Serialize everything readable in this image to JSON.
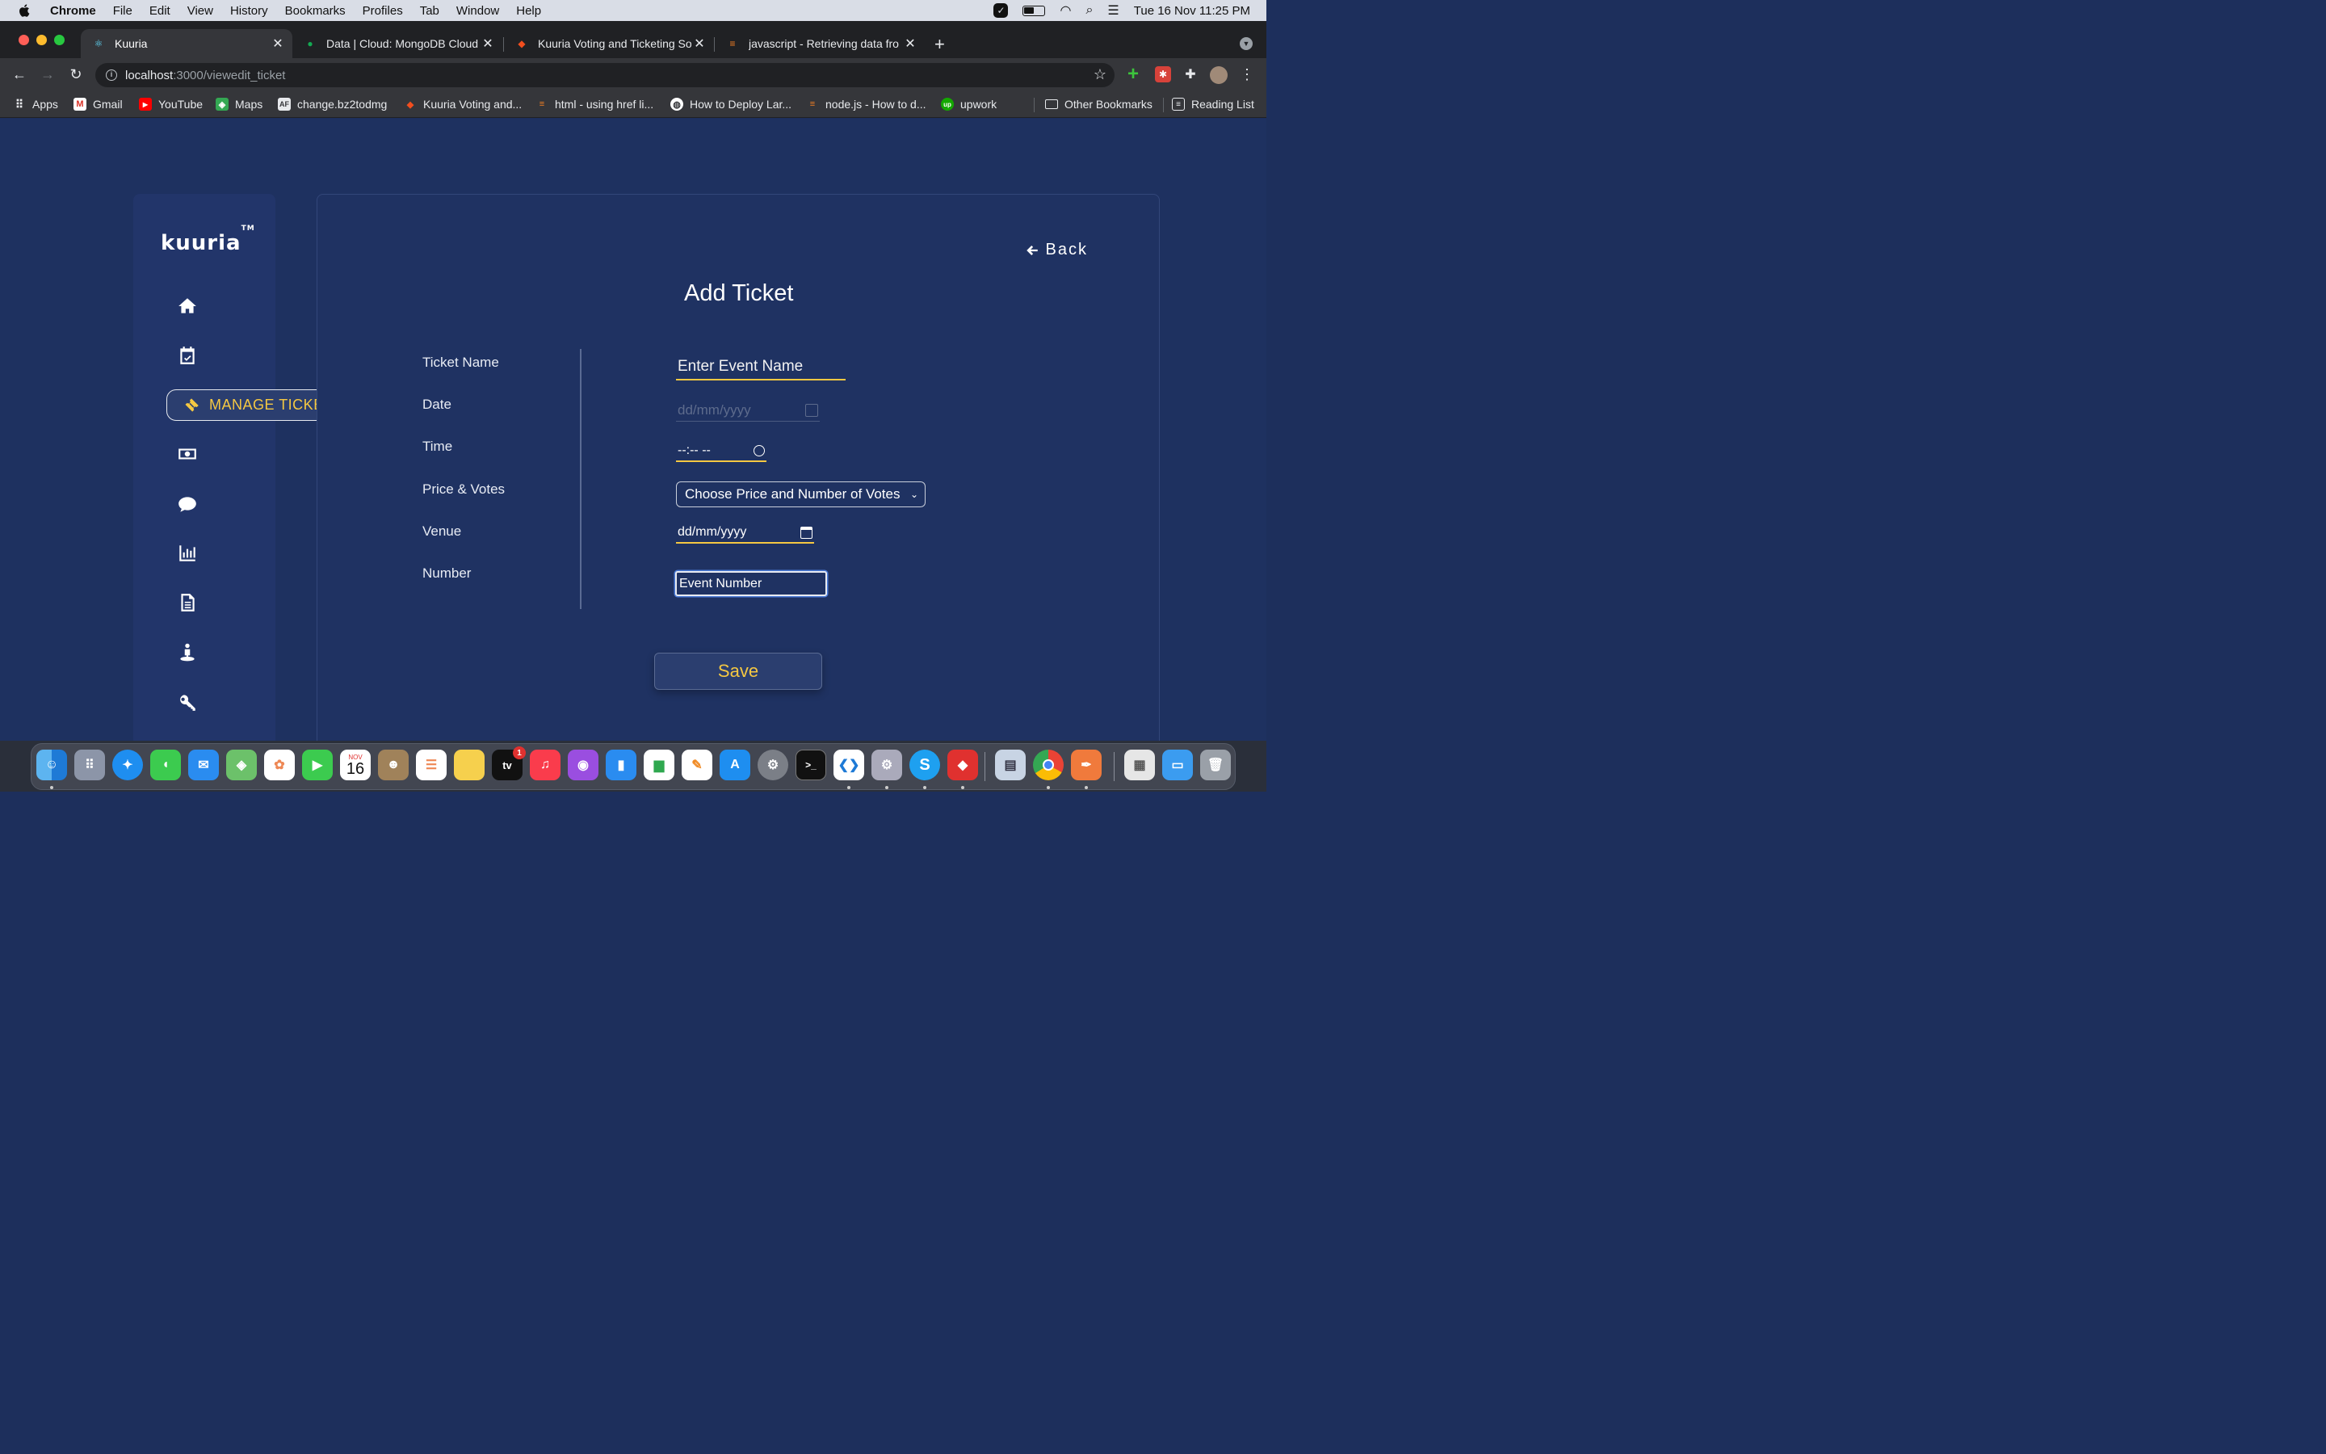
{
  "menubar": {
    "app_name": "Chrome",
    "items": [
      "File",
      "Edit",
      "View",
      "History",
      "Bookmarks",
      "Profiles",
      "Tab",
      "Window",
      "Help"
    ],
    "clock": "Tue 16 Nov  11:25 PM"
  },
  "tabs": [
    {
      "title": "Kuuria",
      "active": true
    },
    {
      "title": "Data | Cloud: MongoDB Cloud",
      "active": false
    },
    {
      "title": "Kuuria Voting and Ticketing So",
      "active": false
    },
    {
      "title": "javascript - Retrieving data fro",
      "active": false
    }
  ],
  "address": {
    "host": "localhost",
    "path": ":3000/viewedit_ticket"
  },
  "bookmarks": [
    {
      "label": "Apps",
      "icon": "apps-grid-icon"
    },
    {
      "label": "Gmail",
      "icon": "gmail-icon"
    },
    {
      "label": "YouTube",
      "icon": "youtube-icon"
    },
    {
      "label": "Maps",
      "icon": "maps-icon"
    },
    {
      "label": "change.bz2todmg",
      "icon": "af-icon"
    },
    {
      "label": "Kuuria Voting and...",
      "icon": "figma-icon"
    },
    {
      "label": "html - using href li...",
      "icon": "stackoverflow-icon"
    },
    {
      "label": "How to Deploy Lar...",
      "icon": "globe-icon"
    },
    {
      "label": "node.js - How to d...",
      "icon": "stackoverflow-icon"
    },
    {
      "label": "upwork",
      "icon": "upwork-icon"
    }
  ],
  "bookmarks_right": {
    "other": "Other Bookmarks",
    "reading": "Reading List"
  },
  "app": {
    "logo": "kuuria",
    "logo_tm": "TM",
    "active_nav": "MANAGE TICKET",
    "back_label": "Back",
    "title": "Add Ticket",
    "form": {
      "labels": [
        "Ticket Name",
        "Date",
        "Time",
        "Price & Votes",
        "Venue",
        "Number"
      ],
      "ticket_name_placeholder": "Enter Event Name",
      "date_placeholder": "dd/mm/yyyy",
      "time_placeholder": "--:-- --",
      "price_votes_selected": "Choose Price and Number of Votes",
      "venue_placeholder": "dd/mm/yyyy",
      "number_placeholder": "Event Number"
    },
    "save_label": "Save"
  },
  "dock": {
    "calendar_month": "NOV",
    "calendar_day": "16",
    "appletv_badge": "1"
  },
  "colors": {
    "accent": "#f5c842",
    "background": "#1e3160",
    "panel": "#1f3262"
  }
}
